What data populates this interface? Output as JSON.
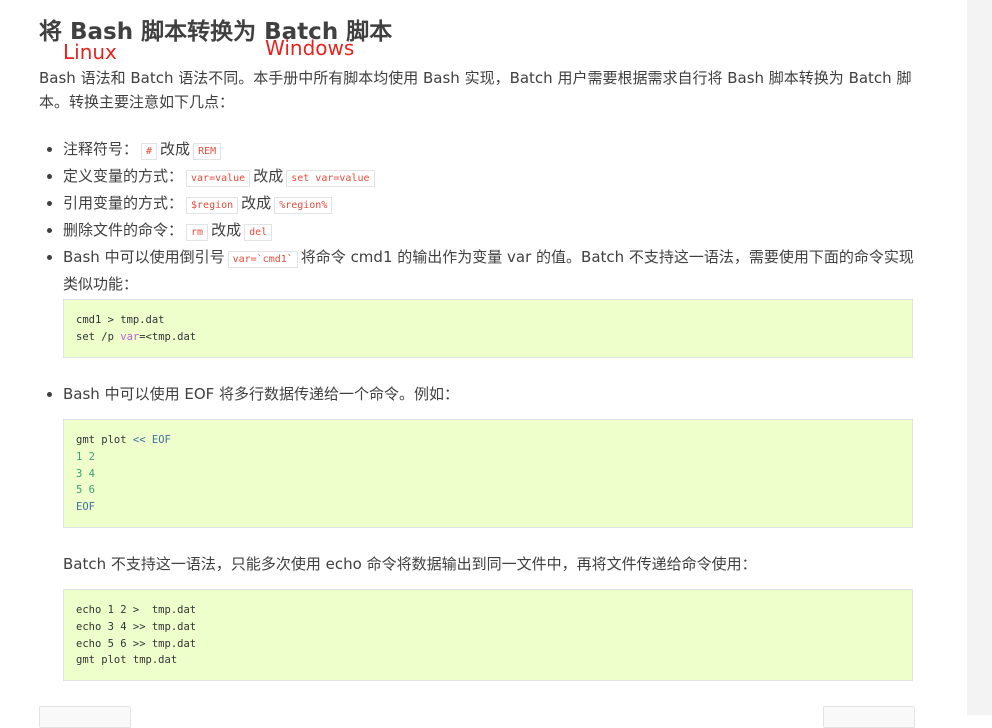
{
  "title": "将 Bash 脚本转换为 Batch 脚本",
  "annotations": {
    "linux": "Linux",
    "windows": "Windows"
  },
  "intro": "Bash 语法和 Batch 语法不同。本手册中所有脚本均使用 Bash 实现，Batch 用户需要根据需求自行将 Bash 脚本转换为 Batch 脚本。转换主要注意如下几点：",
  "points": [
    {
      "label": "注释符号：",
      "from": "#",
      "sep": "改成",
      "to": "REM"
    },
    {
      "label": "定义变量的方式：",
      "from": "var=value",
      "sep": "改成",
      "to": "set var=value"
    },
    {
      "label": "引用变量的方式：",
      "from": "$region",
      "sep": "改成",
      "to": "%region%"
    },
    {
      "label": "删除文件的命令：",
      "from": "rm",
      "sep": "改成",
      "to": "del"
    }
  ],
  "backtick_point": {
    "before": "Bash 中可以使用倒引号",
    "code": "var=`cmd1`",
    "after": "将命令 cmd1 的输出作为变量 var 的值。Batch 不支持这一语法，需要使用下面的命令实现类似功能："
  },
  "code1": {
    "line1": "cmd1 > tmp.dat",
    "line2_a": "set /p ",
    "line2_var": "var",
    "line2_b": "=<tmp.dat"
  },
  "eof_point": "Bash 中可以使用 EOF 将多行数据传递给一个命令。例如：",
  "code2": {
    "cmd": "gmt plot ",
    "heredoc": "<< EOF",
    "rows": [
      "1 2",
      "3 4",
      "5 6"
    ],
    "end": "EOF"
  },
  "para2": "Batch 不支持这一语法，只能多次使用 echo 命令将数据输出到同一文件中，再将文件传递给命令使用：",
  "code3": {
    "lines": [
      "echo 1 2 >  tmp.dat",
      "echo 3 4 >> tmp.dat",
      "echo 5 6 >> tmp.dat",
      "gmt plot tmp.dat"
    ]
  }
}
